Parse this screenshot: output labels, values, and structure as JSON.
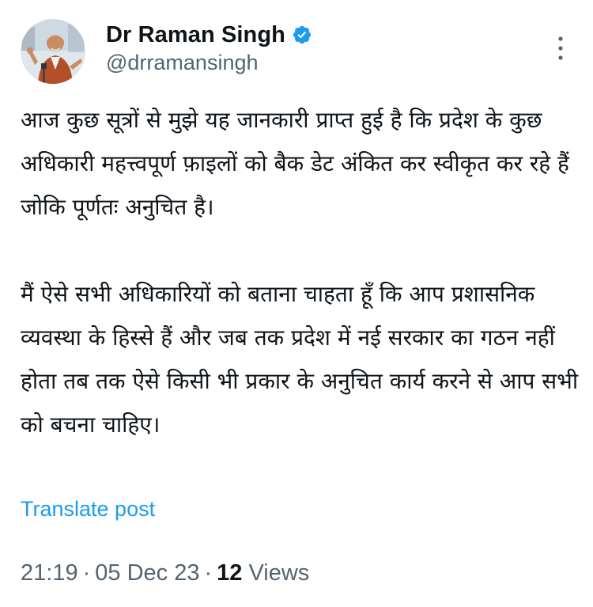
{
  "author": {
    "display_name": "Dr Raman Singh",
    "handle": "@drramansingh",
    "verified": true,
    "verified_color": "#1d9bf0"
  },
  "icons": {
    "verified": "verified-badge-icon",
    "more": "more-vertical-icon"
  },
  "tweet": {
    "paragraphs": [
      "आज कुछ सूत्रों से मुझे यह जानकारी प्राप्त हुई है कि प्रदेश के कुछ अधिकारी महत्त्वपूर्ण फ़ाइलों को बैक डेट अंकित कर स्वीकृत कर रहे हैं जोकि पूर्णतः अनुचित है।",
      "मैं ऐसे सभी अधिकारियों को बताना चाहता हूँ कि आप प्रशासनिक व्यवस्था के हिस्से हैं और जब तक प्रदेश में नई सरकार का गठन नहीं होता तब तक ऐसे किसी भी प्रकार के अनुचित कार्य करने से आप सभी को बचना चाहिए।"
    ],
    "translate_label": "Translate post"
  },
  "meta": {
    "time": "21:19",
    "separator": "·",
    "date": "05 Dec 23",
    "views_count": "12",
    "views_label": "Views"
  },
  "colors": {
    "text": "#0f1419",
    "secondary": "#536471",
    "link": "#1d9bf0"
  }
}
